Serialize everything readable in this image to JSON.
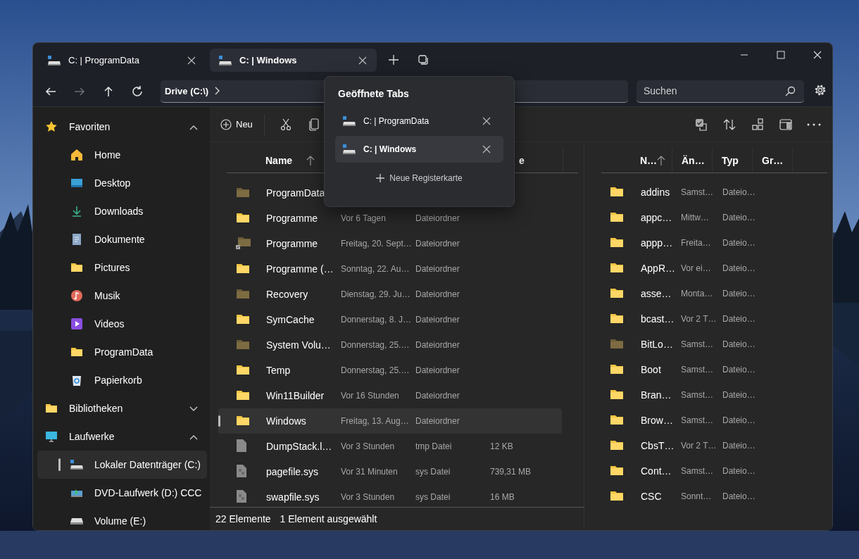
{
  "tabs": [
    {
      "label": "C: | ProgramData",
      "selected": false
    },
    {
      "label": "C: | Windows",
      "selected": true
    }
  ],
  "navigation": [
    {
      "kind": "back",
      "disabled": false
    },
    {
      "kind": "forward",
      "disabled": true
    },
    {
      "kind": "up",
      "disabled": false
    },
    {
      "kind": "refresh",
      "disabled": false
    }
  ],
  "address": {
    "crumb": "Drive (C:\\)"
  },
  "search": {
    "placeholder": "Suchen"
  },
  "sidebar": {
    "sections": [
      {
        "label": "Favoriten",
        "kind": "star",
        "expanded": true,
        "children": [
          {
            "label": "Home",
            "kind": "home",
            "selected": false
          },
          {
            "label": "Desktop",
            "kind": "desktop",
            "selected": false
          },
          {
            "label": "Downloads",
            "kind": "download",
            "selected": false
          },
          {
            "label": "Dokumente",
            "kind": "document",
            "selected": false
          },
          {
            "label": "Pictures",
            "kind": "folder",
            "selected": false
          },
          {
            "label": "Musik",
            "kind": "music",
            "selected": false
          },
          {
            "label": "Videos",
            "kind": "video",
            "selected": false
          },
          {
            "label": "ProgramData",
            "kind": "folder",
            "selected": false
          },
          {
            "label": "Papierkorb",
            "kind": "recycle",
            "selected": false
          }
        ]
      },
      {
        "label": "Bibliotheken",
        "kind": "folder",
        "expanded": false
      },
      {
        "label": "Laufwerke",
        "kind": "monitor",
        "expanded": true,
        "children": [
          {
            "label": "Lokaler Datenträger (C:)",
            "kind": "drive",
            "selected": true
          },
          {
            "label": "DVD-Laufwerk (D:) CCC",
            "kind": "dvd",
            "selected": false
          },
          {
            "label": "Volume (E:)",
            "kind": "volume",
            "selected": false
          }
        ]
      }
    ]
  },
  "toolbar": {
    "new_label": "Neu"
  },
  "file_list": {
    "columns": [
      {
        "label": "Name",
        "sorted": true
      },
      {
        "label": "e",
        "sorted": false
      }
    ],
    "rows": [
      {
        "name": "ProgramData",
        "kind": "folder-dim",
        "selected": false
      },
      {
        "name": "Programme",
        "modified": "Vor 6 Tagen",
        "type": "Dateiordner",
        "kind": "folder",
        "selected": false
      },
      {
        "name": "Programme",
        "modified": "Freitag, 20. Sept…",
        "type": "Dateiordner",
        "kind": "folder-link",
        "selected": false
      },
      {
        "name": "Programme (…",
        "modified": "Sonntag, 22. Au…",
        "type": "Dateiordner",
        "kind": "folder",
        "selected": false
      },
      {
        "name": "Recovery",
        "modified": "Dienstag, 29. Ju…",
        "type": "Dateiordner",
        "kind": "folder-dim",
        "selected": false
      },
      {
        "name": "SymCache",
        "modified": "Donnerstag, 8. J…",
        "type": "Dateiordner",
        "kind": "folder",
        "selected": false
      },
      {
        "name": "System Volu…",
        "modified": "Donnerstag, 25.…",
        "type": "Dateiordner",
        "kind": "folder-dim",
        "selected": false
      },
      {
        "name": "Temp",
        "modified": "Donnerstag, 25.…",
        "type": "Dateiordner",
        "kind": "folder",
        "selected": false
      },
      {
        "name": "Win11Builder",
        "modified": "Vor 16 Stunden",
        "type": "Dateiordner",
        "kind": "folder",
        "selected": false
      },
      {
        "name": "Windows",
        "modified": "Freitag, 13. Aug…",
        "type": "Dateiordner",
        "kind": "folder",
        "selected": true
      },
      {
        "name": "DumpStack.l…",
        "modified": "Vor 3 Stunden",
        "type": "tmp Datei",
        "size": "12 KB",
        "kind": "file",
        "selected": false
      },
      {
        "name": "pagefile.sys",
        "modified": "Vor 31 Minuten",
        "type": "sys Datei",
        "size": "739,31 MB",
        "kind": "sysfile",
        "selected": false
      },
      {
        "name": "swapfile.sys",
        "modified": "Vor 3 Stunden",
        "type": "sys Datei",
        "size": "16 MB",
        "kind": "sysfile",
        "selected": false
      }
    ]
  },
  "tab_popup": {
    "title": "Geöffnete Tabs",
    "tabs": [
      {
        "label": "C: | ProgramData",
        "selected": false
      },
      {
        "label": "C: | Windows",
        "selected": true
      }
    ],
    "new_tab": "Neue Registerkarte"
  },
  "preview_list": {
    "columns": [
      {
        "label": "N…",
        "sorted": true
      },
      {
        "label": "Än…",
        "sorted": false
      },
      {
        "label": "Typ",
        "sorted": false
      },
      {
        "label": "Gr…",
        "sorted": false
      }
    ],
    "rows": [
      {
        "name": "addins",
        "modified": "Samst…",
        "type": "Dateio…",
        "kind": "folder"
      },
      {
        "name": "appc…",
        "modified": "Mittw…",
        "type": "Dateio…",
        "kind": "folder"
      },
      {
        "name": "appp…",
        "modified": "Freita…",
        "type": "Dateio…",
        "kind": "folder"
      },
      {
        "name": "AppR…",
        "modified": "Vor ei…",
        "type": "Dateio…",
        "kind": "folder"
      },
      {
        "name": "asse…",
        "modified": "Monta…",
        "type": "Dateio…",
        "kind": "folder"
      },
      {
        "name": "bcast…",
        "modified": "Vor 2 T…",
        "type": "Dateio…",
        "kind": "folder"
      },
      {
        "name": "BitLo…",
        "modified": "Samst…",
        "type": "Dateio…",
        "kind": "folder-dim"
      },
      {
        "name": "Boot",
        "modified": "Samst…",
        "type": "Dateio…",
        "kind": "folder"
      },
      {
        "name": "Bran…",
        "modified": "Samst…",
        "type": "Dateio…",
        "kind": "folder"
      },
      {
        "name": "Brow…",
        "modified": "Samst…",
        "type": "Dateio…",
        "kind": "folder"
      },
      {
        "name": "CbsT…",
        "modified": "Vor 2 T…",
        "type": "Dateio…",
        "kind": "folder"
      },
      {
        "name": "Cont…",
        "modified": "Samst…",
        "type": "Dateio…",
        "kind": "folder"
      },
      {
        "name": "CSC",
        "modified": "Sonnt…",
        "type": "Dateio…",
        "kind": "folder"
      }
    ]
  },
  "status_bar": {
    "count": "22 Elemente",
    "selection": "1 Element ausgewählt"
  }
}
